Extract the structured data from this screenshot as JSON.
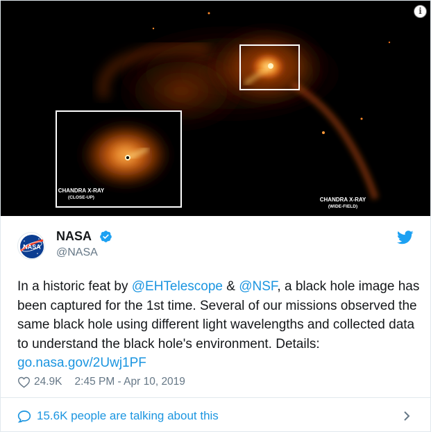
{
  "media": {
    "info_label": "i",
    "caption_closeup_title": "CHANDRA X-RAY",
    "caption_closeup_sub": "(CLOSE-UP)",
    "caption_wide_title": "CHANDRA X-RAY",
    "caption_wide_sub": "(WIDE-FIELD)",
    "box_color": "#ffffff",
    "glow_color": "#ff7a1a"
  },
  "author": {
    "avatar_text": "NASA",
    "name": "NASA",
    "handle": "@NASA",
    "verified_icon": "verified-badge-icon",
    "brand_icon": "twitter-bird-icon",
    "accent_color": "#1da1f2"
  },
  "tweet": {
    "text_1": "In a historic feat by ",
    "mention_1": "@EHTelescope",
    "text_2": " & ",
    "mention_2": "@NSF",
    "text_3": ", a black hole image has been captured for the 1st time. Several of our missions observed the same black hole using different light wavelengths and collected data to understand the black hole's environment. Details: ",
    "link": "go.nasa.gov/2Uwj1PF",
    "link_color": "#1b95e0"
  },
  "meta": {
    "likes": "24.9K",
    "timestamp": "2:45 PM - Apr 10, 2019",
    "like_icon": "heart-outline-icon"
  },
  "footer": {
    "talking": "15.6K people are talking about this",
    "icon": "comment-bubble-icon",
    "chevron": "chevron-right-icon"
  }
}
